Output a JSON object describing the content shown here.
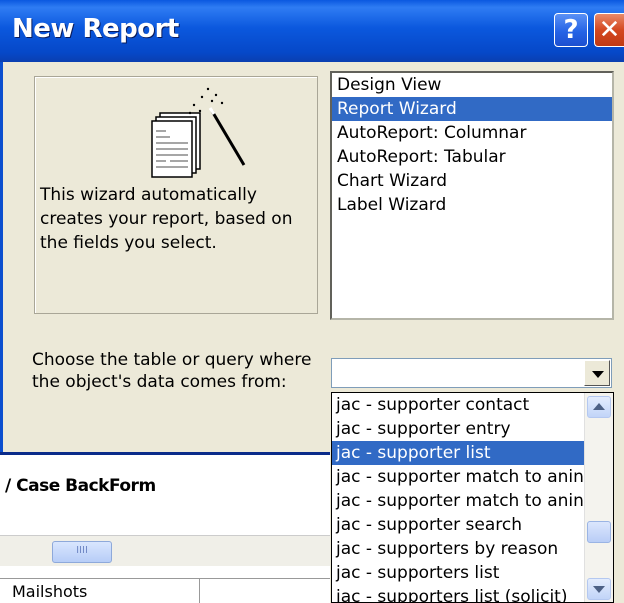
{
  "window": {
    "title": "New Report",
    "help_glyph": "?",
    "close_glyph": "✕"
  },
  "preview": {
    "icon": "report-wizard-icon",
    "description": "This wizard automatically creates your report, based on the fields you select."
  },
  "report_types": {
    "items": [
      "Design View",
      "Report Wizard",
      "AutoReport:  Columnar",
      "AutoReport:  Tabular",
      "Chart Wizard",
      "Label Wizard"
    ],
    "selected": "Report Wizard"
  },
  "source": {
    "label": "Choose the table or query where the object's data comes from:",
    "value": ""
  },
  "dropdown": {
    "items": [
      "jac - supporter contact",
      "jac - supporter entry",
      "jac - supporter list",
      "jac - supporter match to anin",
      "jac - supporter match to anin",
      "jac - supporter search",
      "jac - supporters by reason",
      "jac - supporters list",
      "jac - supporters list (solicit)"
    ],
    "selected_index": 2
  },
  "background": {
    "fragment_text": "/ Case BackForm",
    "scroll_grip": "IIII",
    "tab_label": "Mailshots"
  },
  "colors": {
    "title_bar": "#0b58de",
    "selection": "#316ac5",
    "dialog_bg": "#ece9d8"
  }
}
